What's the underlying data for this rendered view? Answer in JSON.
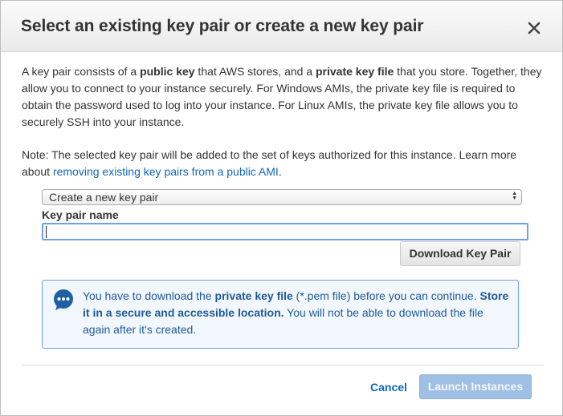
{
  "dialog": {
    "title": "Select an existing key pair or create a new key pair",
    "close_icon": "close-icon"
  },
  "description": {
    "p1_part1": "A key pair consists of a ",
    "p1_bold1": "public key",
    "p1_part2": " that AWS stores, and a ",
    "p1_bold2": "private key file",
    "p1_part3": " that you store. Together, they allow you to connect to your instance securely. For Windows AMIs, the private key file is required to obtain the password used to log into your instance. For Linux AMIs, the private key file allows you to securely SSH into your instance.",
    "note_text": "Note: The selected key pair will be added to the set of keys authorized for this instance. Learn more about ",
    "note_link": "removing existing key pairs from a public AMI",
    "note_end": "."
  },
  "key_pair_select": {
    "selected": "Create a new key pair",
    "arrows_icon": "select-arrows-icon"
  },
  "key_pair_name": {
    "label": "Key pair name",
    "value": "",
    "placeholder": ""
  },
  "download_button": {
    "label": "Download Key Pair"
  },
  "info": {
    "icon": "speech-bubble-icon",
    "t1": "You have to download the ",
    "b1": "private key file",
    "t2": " (*.pem file) before you can continue. ",
    "b2": "Store it in a secure and accessible location.",
    "t3": " You will not be able to download the file again after it's created."
  },
  "footer": {
    "cancel_label": "Cancel",
    "launch_label": "Launch Instances"
  },
  "colors": {
    "link": "#1166bb",
    "info_border": "#6aa2d8",
    "info_bg": "#f1f7fd",
    "primary_disabled": "#9fc0e4"
  }
}
